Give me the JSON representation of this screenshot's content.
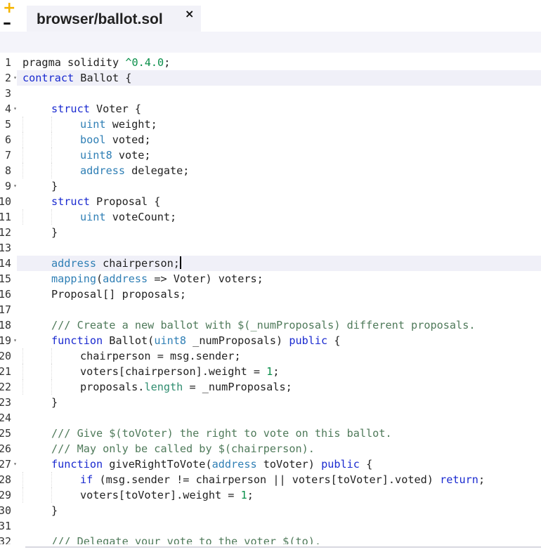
{
  "toolbar": {
    "zoom_in_label": "+",
    "zoom_out_label": "–"
  },
  "tab": {
    "title": "browser/ballot.sol",
    "close_label": "×"
  },
  "editor": {
    "active_lines": [
      2,
      14
    ],
    "fold_lines": [
      2,
      4,
      9,
      19,
      27
    ],
    "lines": [
      {
        "n": "1",
        "indent": 0,
        "tokens": [
          [
            "plain",
            "pragma solidity "
          ],
          [
            "num",
            "^0.4.0"
          ],
          [
            "plain",
            ";"
          ]
        ]
      },
      {
        "n": "2",
        "indent": 0,
        "tokens": [
          [
            "kw",
            "contract"
          ],
          [
            "plain",
            " Ballot {"
          ]
        ]
      },
      {
        "n": "3",
        "indent": 0,
        "tokens": []
      },
      {
        "n": "4",
        "indent": 1,
        "tokens": [
          [
            "kw",
            "struct"
          ],
          [
            "plain",
            " Voter {"
          ]
        ]
      },
      {
        "n": "5",
        "indent": 2,
        "tokens": [
          [
            "type",
            "uint"
          ],
          [
            "plain",
            " weight;"
          ]
        ]
      },
      {
        "n": "6",
        "indent": 2,
        "tokens": [
          [
            "type",
            "bool"
          ],
          [
            "plain",
            " voted;"
          ]
        ]
      },
      {
        "n": "7",
        "indent": 2,
        "tokens": [
          [
            "type",
            "uint8"
          ],
          [
            "plain",
            " vote;"
          ]
        ]
      },
      {
        "n": "8",
        "indent": 2,
        "tokens": [
          [
            "type",
            "address"
          ],
          [
            "plain",
            " delegate;"
          ]
        ]
      },
      {
        "n": "9",
        "indent": 1,
        "tokens": [
          [
            "plain",
            "}"
          ]
        ]
      },
      {
        "n": "10",
        "indent": 1,
        "tokens": [
          [
            "kw",
            "struct"
          ],
          [
            "plain",
            " Proposal {"
          ]
        ]
      },
      {
        "n": "11",
        "indent": 2,
        "tokens": [
          [
            "type",
            "uint"
          ],
          [
            "plain",
            " voteCount;"
          ]
        ]
      },
      {
        "n": "12",
        "indent": 1,
        "tokens": [
          [
            "plain",
            "}"
          ]
        ]
      },
      {
        "n": "13",
        "indent": 0,
        "tokens": []
      },
      {
        "n": "14",
        "indent": 1,
        "tokens": [
          [
            "type",
            "address"
          ],
          [
            "plain",
            " chairperson;"
          ]
        ],
        "cursor": true
      },
      {
        "n": "15",
        "indent": 1,
        "tokens": [
          [
            "type",
            "mapping"
          ],
          [
            "plain",
            "("
          ],
          [
            "type",
            "address"
          ],
          [
            "plain",
            " => Voter) voters;"
          ]
        ]
      },
      {
        "n": "16",
        "indent": 1,
        "tokens": [
          [
            "plain",
            "Proposal[] proposals;"
          ]
        ]
      },
      {
        "n": "17",
        "indent": 0,
        "tokens": []
      },
      {
        "n": "18",
        "indent": 1,
        "tokens": [
          [
            "cmt",
            "/// Create a new ballot with $(_numProposals) different proposals."
          ]
        ]
      },
      {
        "n": "19",
        "indent": 1,
        "tokens": [
          [
            "kw",
            "function"
          ],
          [
            "plain",
            " Ballot("
          ],
          [
            "type",
            "uint8"
          ],
          [
            "plain",
            " _numProposals) "
          ],
          [
            "kw",
            "public"
          ],
          [
            "plain",
            " {"
          ]
        ]
      },
      {
        "n": "20",
        "indent": 2,
        "tokens": [
          [
            "plain",
            "chairperson = msg.sender;"
          ]
        ]
      },
      {
        "n": "21",
        "indent": 2,
        "tokens": [
          [
            "plain",
            "voters[chairperson].weight = "
          ],
          [
            "num",
            "1"
          ],
          [
            "plain",
            ";"
          ]
        ]
      },
      {
        "n": "22",
        "indent": 2,
        "tokens": [
          [
            "plain",
            "proposals."
          ],
          [
            "prop",
            "length"
          ],
          [
            "plain",
            " = _numProposals;"
          ]
        ]
      },
      {
        "n": "23",
        "indent": 1,
        "tokens": [
          [
            "plain",
            "}"
          ]
        ]
      },
      {
        "n": "24",
        "indent": 0,
        "tokens": []
      },
      {
        "n": "25",
        "indent": 1,
        "tokens": [
          [
            "cmt",
            "/// Give $(toVoter) the right to vote on this ballot."
          ]
        ]
      },
      {
        "n": "26",
        "indent": 1,
        "tokens": [
          [
            "cmt",
            "/// May only be called by $(chairperson)."
          ]
        ]
      },
      {
        "n": "27",
        "indent": 1,
        "tokens": [
          [
            "kw",
            "function"
          ],
          [
            "plain",
            " giveRightToVote("
          ],
          [
            "type",
            "address"
          ],
          [
            "plain",
            " toVoter) "
          ],
          [
            "kw",
            "public"
          ],
          [
            "plain",
            " {"
          ]
        ]
      },
      {
        "n": "28",
        "indent": 2,
        "tokens": [
          [
            "kw",
            "if"
          ],
          [
            "plain",
            " (msg.sender != chairperson || voters[toVoter].voted) "
          ],
          [
            "kw",
            "return"
          ],
          [
            "plain",
            ";"
          ]
        ]
      },
      {
        "n": "29",
        "indent": 2,
        "tokens": [
          [
            "plain",
            "voters[toVoter].weight = "
          ],
          [
            "num",
            "1"
          ],
          [
            "plain",
            ";"
          ]
        ]
      },
      {
        "n": "30",
        "indent": 1,
        "tokens": [
          [
            "plain",
            "}"
          ]
        ]
      },
      {
        "n": "31",
        "indent": 0,
        "tokens": []
      },
      {
        "n": "32",
        "indent": 1,
        "tokens": [
          [
            "cmt",
            "/// Delegate your vote to the voter $(to)."
          ]
        ]
      }
    ]
  }
}
